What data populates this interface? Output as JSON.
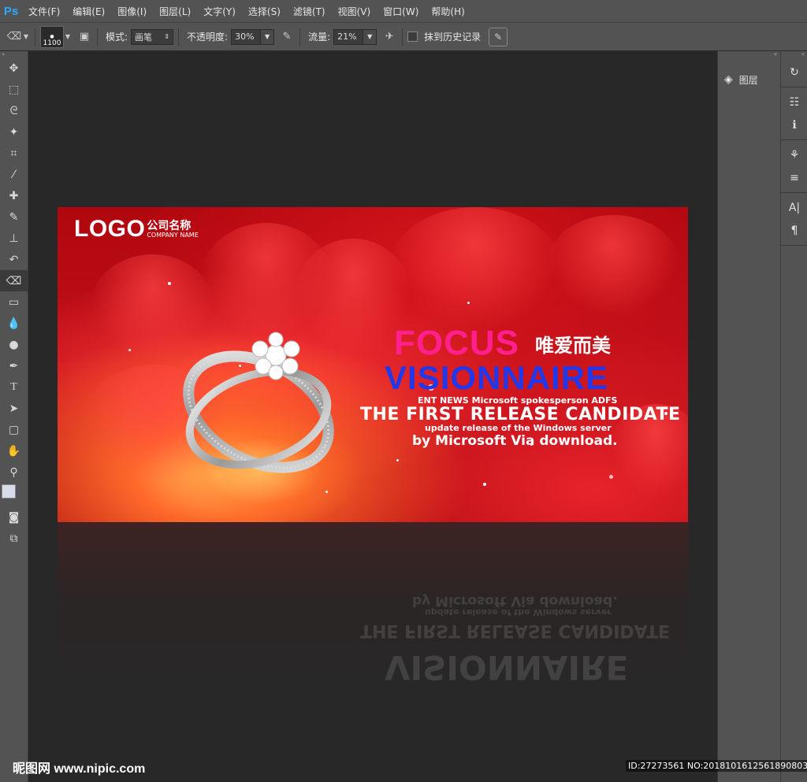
{
  "app": {
    "logo": "Ps"
  },
  "menu": [
    "文件(F)",
    "编辑(E)",
    "图像(I)",
    "图层(L)",
    "文字(Y)",
    "选择(S)",
    "滤镜(T)",
    "视图(V)",
    "窗口(W)",
    "帮助(H)"
  ],
  "options": {
    "brush_size": "1100",
    "mode_label": "模式:",
    "mode_value": "画笔",
    "opacity_label": "不透明度:",
    "opacity_value": "30%",
    "flow_label": "流量:",
    "flow_value": "21%",
    "history_label": "抹到历史记录"
  },
  "panels": {
    "layers_label": "图层"
  },
  "canvas": {
    "logo_text": "LOGO",
    "company_cn": "公司名称",
    "company_en": "COMPANY NAME",
    "focus": "FOCUS",
    "cn_slogan": "唯爱而美",
    "visionnaire": "VISIONNAIRE",
    "line1": "ENT NEWS Microsoft spokesperson ADFS",
    "line2": "THE FIRST RELEASE CANDIDATE",
    "line3": "update release of the Windows server",
    "line4": "by Microsoft Via download."
  },
  "watermark": {
    "left": "昵图网 www.nipic.com",
    "right": "ID:27273561 NO:20181016125618908039"
  },
  "colors": {
    "focus": "#ff1f8e",
    "visionnaire": "#2338e8",
    "ui_gray": "#535353",
    "workspace": "#282828"
  }
}
